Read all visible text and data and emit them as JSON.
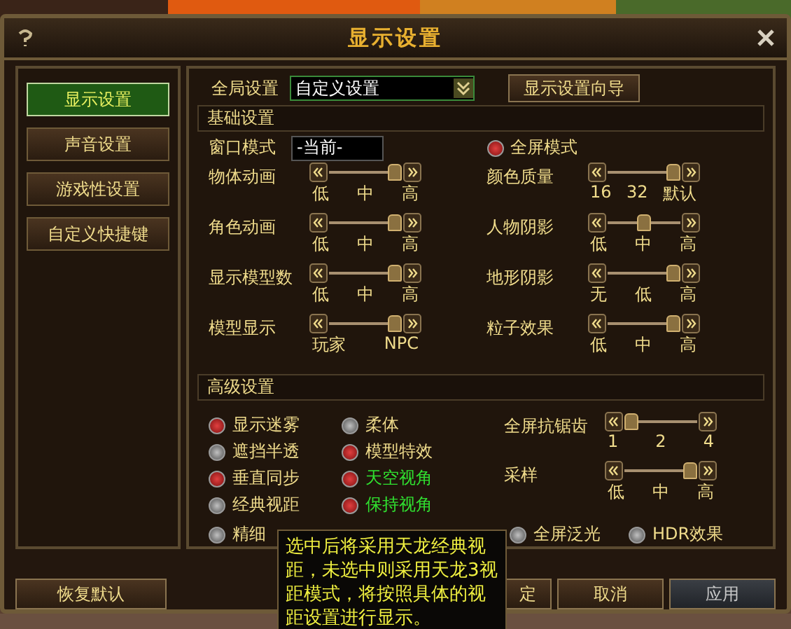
{
  "window": {
    "title": "显示设置"
  },
  "sidebar": {
    "items": [
      {
        "label": "显示设置",
        "selected": true
      },
      {
        "label": "声音设置",
        "selected": false
      },
      {
        "label": "游戏性设置",
        "selected": false
      },
      {
        "label": "自定义快捷键",
        "selected": false
      }
    ],
    "restore_button": "恢复默认"
  },
  "global": {
    "label": "全局设置",
    "value": "自定义设置",
    "wizard_button": "显示设置向导"
  },
  "basic": {
    "title": "基础设置",
    "window_mode": {
      "label": "窗口模式",
      "value": "-当前-"
    },
    "fullscreen": {
      "label": "全屏模式",
      "checked": true
    },
    "sliders": [
      {
        "label": "物体动画",
        "level": 1,
        "ticks": [
          "低",
          "中",
          "高"
        ]
      },
      {
        "label": "颜色质量",
        "level": 1,
        "ticks": [
          "16",
          "32",
          "默认"
        ]
      },
      {
        "label": "角色动画",
        "level": 1,
        "ticks": [
          "低",
          "中",
          "高"
        ]
      },
      {
        "label": "人物阴影",
        "level": 0.5,
        "ticks": [
          "低",
          "中",
          "高"
        ]
      },
      {
        "label": "显示模型数",
        "level": 1,
        "ticks": [
          "低",
          "中",
          "高"
        ]
      },
      {
        "label": "地形阴影",
        "level": 1,
        "ticks": [
          "无",
          "低",
          "高"
        ]
      },
      {
        "label": "模型显示",
        "level": 1,
        "ticks": [
          "玩家",
          "NPC"
        ]
      },
      {
        "label": "粒子效果",
        "level": 1,
        "ticks": [
          "低",
          "中",
          "高"
        ]
      }
    ]
  },
  "advanced": {
    "title": "高级设置",
    "options": [
      {
        "label": "显示迷雾",
        "checked": true,
        "highlight": false
      },
      {
        "label": "柔体",
        "checked": false,
        "highlight": false
      },
      {
        "label": "遮挡半透",
        "checked": false,
        "highlight": false
      },
      {
        "label": "模型特效",
        "checked": true,
        "highlight": false
      },
      {
        "label": "垂直同步",
        "checked": true,
        "highlight": false
      },
      {
        "label": "天空视角",
        "checked": true,
        "highlight": true
      },
      {
        "label": "经典视距",
        "checked": false,
        "highlight": false
      },
      {
        "label": "保持视角",
        "checked": true,
        "highlight": true
      }
    ],
    "sliders": [
      {
        "label": "全屏抗锯齿",
        "level": 0,
        "ticks": [
          "1",
          "2",
          "4"
        ]
      },
      {
        "label": "采样",
        "level": 1,
        "ticks": [
          "低",
          "中",
          "高"
        ]
      }
    ],
    "bottom_options": [
      {
        "label": "精细",
        "checked": false
      },
      {
        "label": "全屏泛光",
        "checked": false
      },
      {
        "label": "HDR效果",
        "checked": false
      }
    ]
  },
  "tooltip": {
    "text": "选中后将采用天龙经典视距，未选中则采用天龙3视距模式，将按照具体的视距设置进行显示。"
  },
  "buttons": [
    {
      "label": "定",
      "disabled": false
    },
    {
      "label": "取消",
      "disabled": false
    },
    {
      "label": "应用",
      "disabled": true
    }
  ]
}
